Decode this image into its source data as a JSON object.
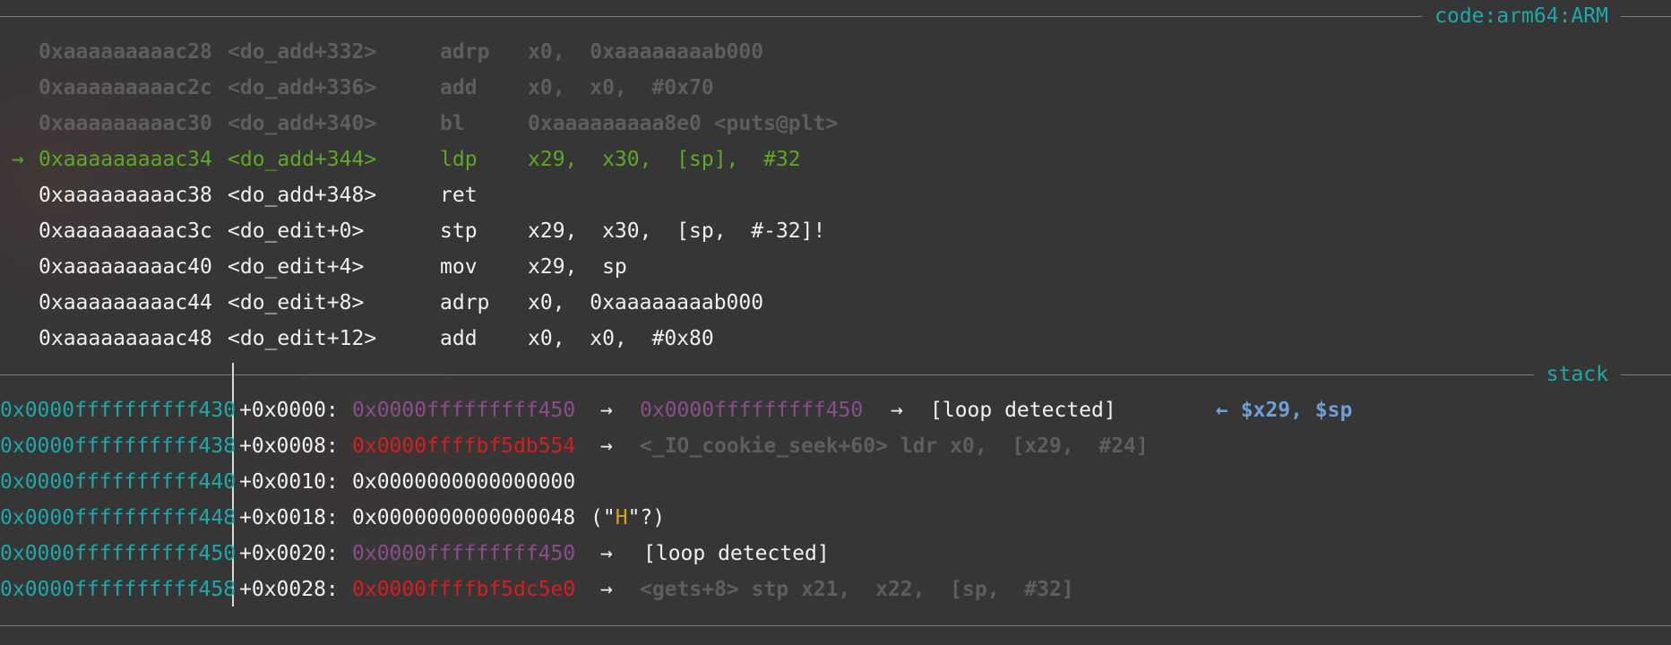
{
  "sections": {
    "code_title": "code:arm64:ARM",
    "stack_title": "stack"
  },
  "code": [
    {
      "style": "faded",
      "marker": "",
      "addr": "0xaaaaaaaaac28",
      "sym": "<do_add+332>",
      "mnem": "adrp",
      "ops": "x0,  0xaaaaaaaab000"
    },
    {
      "style": "faded",
      "marker": "",
      "addr": "0xaaaaaaaaac2c",
      "sym": "<do_add+336>",
      "mnem": "add",
      "ops": "x0,  x0,  #0x70"
    },
    {
      "style": "faded",
      "marker": "",
      "addr": "0xaaaaaaaaac30",
      "sym": "<do_add+340>",
      "mnem": "bl",
      "ops": "0xaaaaaaaaa8e0 <puts@plt>"
    },
    {
      "style": "cur",
      "marker": "→",
      "addr": "0xaaaaaaaaac34",
      "sym": "<do_add+344>",
      "mnem": "ldp",
      "ops": "x29,  x30,  [sp],  #32"
    },
    {
      "style": "white",
      "marker": "",
      "addr": "0xaaaaaaaaac38",
      "sym": "<do_add+348>",
      "mnem": "ret",
      "ops": ""
    },
    {
      "style": "white",
      "marker": "",
      "addr": "0xaaaaaaaaac3c",
      "sym": "<do_edit+0>",
      "mnem": "stp",
      "ops": "x29,  x30,  [sp,  #-32]!"
    },
    {
      "style": "white",
      "marker": "",
      "addr": "0xaaaaaaaaac40",
      "sym": "<do_edit+4>",
      "mnem": "mov",
      "ops": "x29,  sp"
    },
    {
      "style": "white",
      "marker": "",
      "addr": "0xaaaaaaaaac44",
      "sym": "<do_edit+8>",
      "mnem": "adrp",
      "ops": "x0,  0xaaaaaaaab000"
    },
    {
      "style": "white",
      "marker": "",
      "addr": "0xaaaaaaaaac48",
      "sym": "<do_edit+12>",
      "mnem": "add",
      "ops": "x0,  x0,  #0x80"
    }
  ],
  "stack": [
    {
      "addr": "0x0000ffffffffff430",
      "offset": "+0x0000:",
      "value": "0x0000fffffffff450",
      "arrow1": "→",
      "deref": "0x0000fffffffff450",
      "arrow2": "→",
      "info": "[loop detected]",
      "regs": "← $x29, $sp"
    },
    {
      "addr": "0x0000ffffffffff438",
      "offset": "+0x0008:",
      "value": "0x0000ffffbf5db554",
      "arrow1": "→",
      "info": "<_IO_cookie_seek+60> ldr x0,  [x29,  #24]"
    },
    {
      "addr": "0x0000ffffffffff440",
      "offset": "+0x0010:",
      "value": "0x0000000000000000"
    },
    {
      "addr": "0x0000ffffffffff448",
      "offset": "+0x0018:",
      "value": "0x0000000000000048",
      "str_pre": "(\"",
      "str_char": "H",
      "str_post": "\"?)"
    },
    {
      "addr": "0x0000ffffffffff450",
      "offset": "+0x0020:",
      "value": "0x0000fffffffff450",
      "arrow1": "→",
      "info": "[loop detected]"
    },
    {
      "addr": "0x0000ffffffffff458",
      "offset": "+0x0028:",
      "value": "0x0000ffffbf5dc5e0",
      "arrow1": "→",
      "info": "<gets+8> stp x21,  x22,  [sp,  #32]"
    }
  ],
  "colors": {
    "background": "#363636",
    "teal": "#1fa8a8",
    "current_instruction": "#62a626",
    "faded": "#5e5e5e",
    "heap_pointer": "#8a4f8a",
    "code_pointer": "#d41f1f",
    "register_annotation": "#6ea0d6",
    "string_char": "#d6a21e"
  }
}
